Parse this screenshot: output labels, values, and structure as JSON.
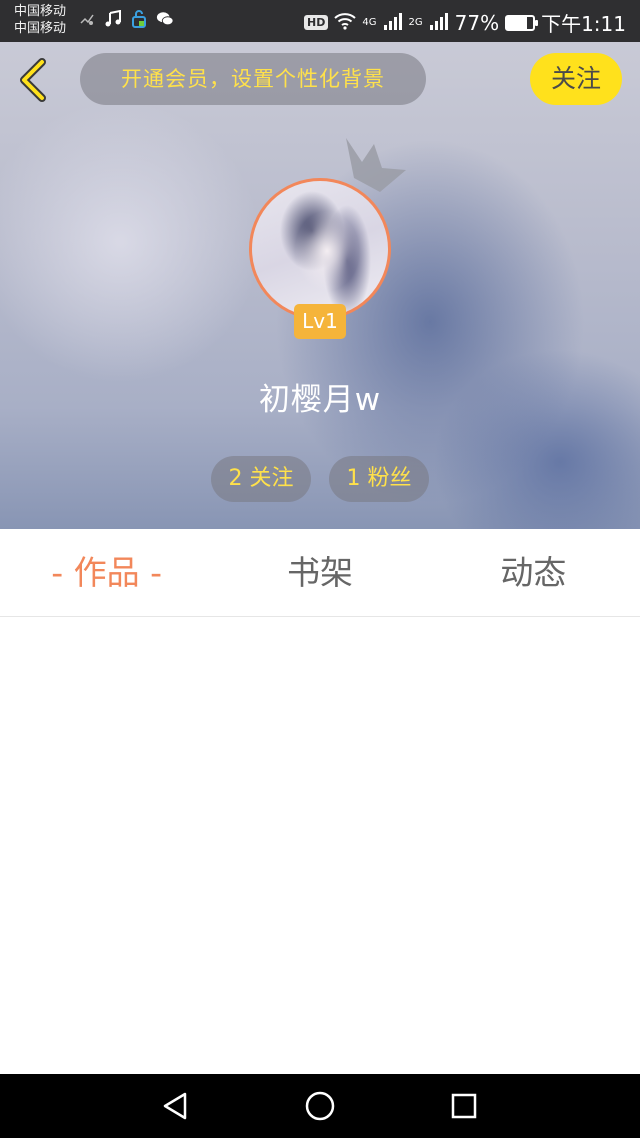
{
  "status_bar": {
    "carrier_1": "中国移动",
    "carrier_2": "中国移动",
    "hd": "HD",
    "net_1": "4G",
    "net_2": "2G",
    "battery_percent": "77%",
    "battery_level": 0.77,
    "time": "下午1:11"
  },
  "header": {
    "promo_text": "开通会员，设置个性化背景",
    "follow_label": "关注"
  },
  "profile": {
    "level": "Lv1",
    "username": "初樱月w",
    "following": "2 关注",
    "fans": "1 粉丝"
  },
  "tabs": [
    {
      "label": "- 作品 -",
      "active": true
    },
    {
      "label": "书架",
      "active": false
    },
    {
      "label": "动态",
      "active": false
    }
  ],
  "colors": {
    "accent": "#f2875a",
    "promo_text": "#ffe14a",
    "follow_button": "#ffe11c",
    "level_badge": "#f5b43a"
  },
  "icons": {
    "back": "chevron-left-icon",
    "crown": "crown-icon",
    "nav_back": "triangle-back-icon",
    "nav_home": "circle-home-icon",
    "nav_recent": "square-recent-icon"
  }
}
